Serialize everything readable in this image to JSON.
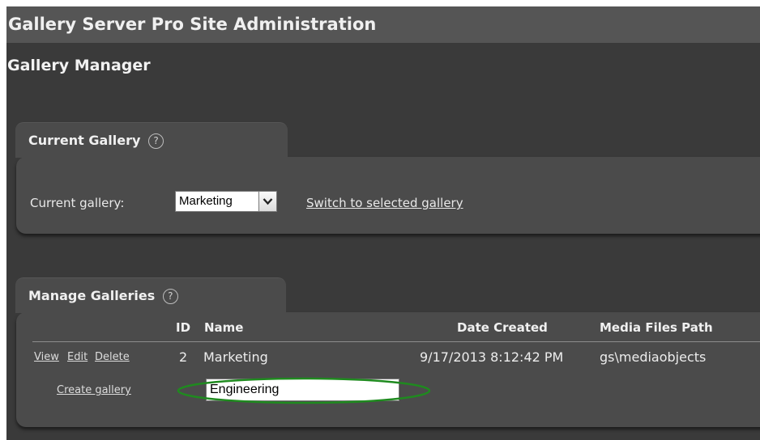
{
  "site_title": "Gallery Server Pro Site Administration",
  "page_title": "Gallery Manager",
  "current_gallery_panel": {
    "tab_label": "Current Gallery",
    "help_glyph": "?",
    "label": "Current gallery:",
    "selected_gallery": "Marketing",
    "switch_link": "Switch to selected gallery"
  },
  "manage_galleries_panel": {
    "tab_label": "Manage Galleries",
    "help_glyph": "?",
    "columns": {
      "id": "ID",
      "name": "Name",
      "date_created": "Date Created",
      "media_path": "Media Files Path"
    },
    "rows": [
      {
        "actions": {
          "view": "View",
          "edit": "Edit",
          "delete": "Delete"
        },
        "id": "2",
        "name": "Marketing",
        "date_created": "9/17/2013 8:12:42 PM",
        "media_path": "gs\\mediaobjects"
      }
    ],
    "create_link": "Create gallery",
    "new_gallery_name": "Engineering"
  },
  "colors": {
    "title_bar": "#555555",
    "background": "#3a3a3a",
    "panel": "#4b4b4b",
    "highlight_ellipse": "#1f8a1f"
  },
  "icons": [
    "help-icon",
    "dropdown-arrow-icon"
  ]
}
